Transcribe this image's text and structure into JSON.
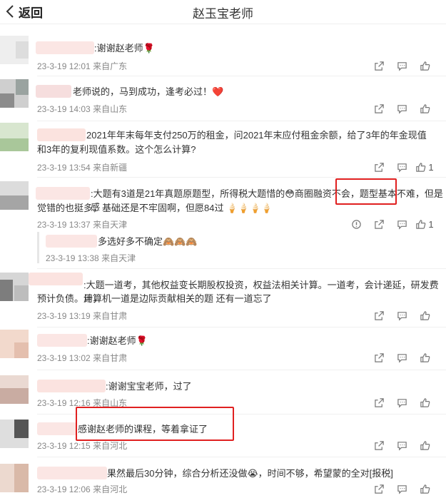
{
  "header": {
    "back_label": "返回",
    "title": "赵玉宝老师"
  },
  "comments": [
    {
      "text": ":谢谢赵老师🌹",
      "time": "23-3-19 12:01",
      "location": "来自广东"
    },
    {
      "text": "老师说的，马到成功，逢考必过！❤️",
      "time": "23-3-19 14:03",
      "location": "来自山东"
    },
    {
      "line1": "2021年年末每年支付250万的租金，问2021年末应付租金余额，给了3年的年金现值",
      "line2": "和3年的复利现值系数。这个怎么计算?",
      "time": "23-3-19 13:54",
      "location": "来自新疆",
      "likes": "1"
    },
    {
      "line1a": ":大题有3道是21年真题原题型，所得税大题惜的😳商圈融资不会，",
      "line1b": "题型基本不难",
      "line1c": "，但是感",
      "line2": "觉错的也挺多，基础还是不牢固啊，但愿84过 🍦🍦🍦🍦",
      "time": "23-3-19 13:37",
      "location": "来自天津",
      "likes": "1"
    },
    {
      "text": "多选好多不确定🙈🙈🙈",
      "time": "23-3-19 13:38",
      "location": "来自天津"
    },
    {
      "line1": ":大题一道考，其他权益变长期股权投资，权益法相关计算。一道考，会计递延，研发费用，",
      "line2": "预计负债。计算机一道是边际贡献相关的题 还有一道忘了",
      "time": "23-3-19 13:19",
      "location": "来自甘肃"
    },
    {
      "text": ":谢谢赵老师🌹",
      "time": "23-3-19 13:02",
      "location": "来自甘肃"
    },
    {
      "text": ":谢谢宝宝老师，过了",
      "time": "23-3-19 12:16",
      "location": "来自山东"
    },
    {
      "text": "感谢赵老师的课程，等着拿证了",
      "time": "23-3-19 12:15",
      "location": "来自河北"
    },
    {
      "text": "果然最后30分钟，综合分析还没做😭，时间不够，希望蒙的全对[报税]",
      "time": "23-3-19 12:06",
      "location": "来自河北"
    }
  ],
  "icons": {
    "share": "share-icon",
    "comment": "comment-icon",
    "like": "thumbs-up-icon",
    "report": "report-icon"
  },
  "colors": {
    "highlight_box": "#e02020"
  }
}
